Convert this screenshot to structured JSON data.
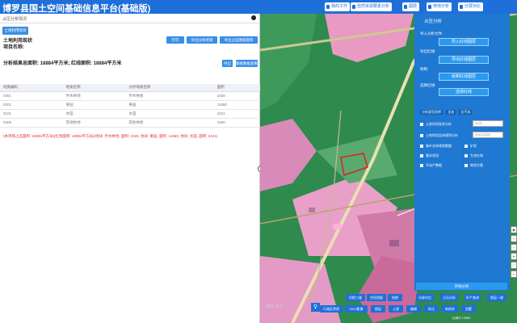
{
  "app": {
    "title": "博罗县国土空间基础信息平台(基础版)",
    "top_buttons": [
      "我的工作",
      "自然资源要素分析",
      "图层",
      "用地分析",
      "分屏对比"
    ]
  },
  "left_panel": {
    "title": "占压分析情况",
    "return_button": "土地利用现状",
    "section_title": "土地利用现状",
    "project_label": "项目名称:",
    "actions": [
      "打印",
      "导出分析结果",
      "导出占压图斑面积"
    ],
    "result_line": "分析结果总面积: 18884平方米; 红线面积: 18884平方米",
    "export_btn": "导出",
    "view_btn": "图斑数据查看",
    "table": {
      "headers": [
        "地类编码",
        "地类名称",
        "分析地类名称",
        "面积"
      ],
      "rows": [
        [
          "0301",
          "乔木林地",
          "乔木林地",
          "2326"
        ],
        [
          "0201",
          "果园",
          "果园",
          "11680"
        ],
        [
          "0101",
          "水田",
          "水田",
          "3421"
        ],
        [
          "0305",
          "其他林地",
          "其他林地",
          "1500"
        ]
      ]
    },
    "summary": "(本项目占压面积: 18884平方米)(红线面积: 18884平方米)(地块: 乔木林地, 面积: 2326; 地块: 果园, 面积: 11680; 地块: 水田, 面积: 3421)"
  },
  "analysis_panel": {
    "title": "占压分析",
    "import_label": "导入分析文件:",
    "import_btn": "导入红线图层",
    "export_label": "导出红线:",
    "export_btn": "导出红线图层",
    "draw_label": "绘制:",
    "draw_btn": "绘制红线图层",
    "select_label": "选择红线:",
    "select_btn": "选择红线",
    "tabs": [
      "分析类型选择",
      "全选",
      "全不选"
    ],
    "options": [
      {
        "label": "土地利用现状分析",
        "checked": true
      },
      {
        "label": "土地利用总体规划分析",
        "checked": false
      },
      {
        "label": "城乡总体规划数据",
        "checked": false
      },
      {
        "label": "基本农田",
        "checked": false
      },
      {
        "label": "不动产数据",
        "checked": false
      },
      {
        "label": "生态红线",
        "checked": false
      },
      {
        "label": "地质灾害",
        "checked": false
      },
      {
        "label": "矿权",
        "checked": false
      }
    ],
    "select1": "2021",
    "select2": "2010-2020",
    "start_btn": "开始分析"
  },
  "bottom": {
    "search_placeholder": "搜索 地点",
    "tools_row1": [
      "切换三维",
      "空间测量",
      "绘制",
      "分屏对比",
      "占压分析",
      "矿产查询",
      "图层一键"
    ],
    "tools_row2": [
      "行政区界线",
      "2021影像",
      "图层",
      "土规",
      "编辑",
      "标注",
      "新闻夹",
      "别墅"
    ],
    "scale": "比例尺 1:3500"
  },
  "colors": {
    "primary": "#1e6fd9",
    "panel": "#1f78d1",
    "map_green": "#2a8a4a",
    "map_pink": "#e8a0c8",
    "redline": "#e02020"
  }
}
